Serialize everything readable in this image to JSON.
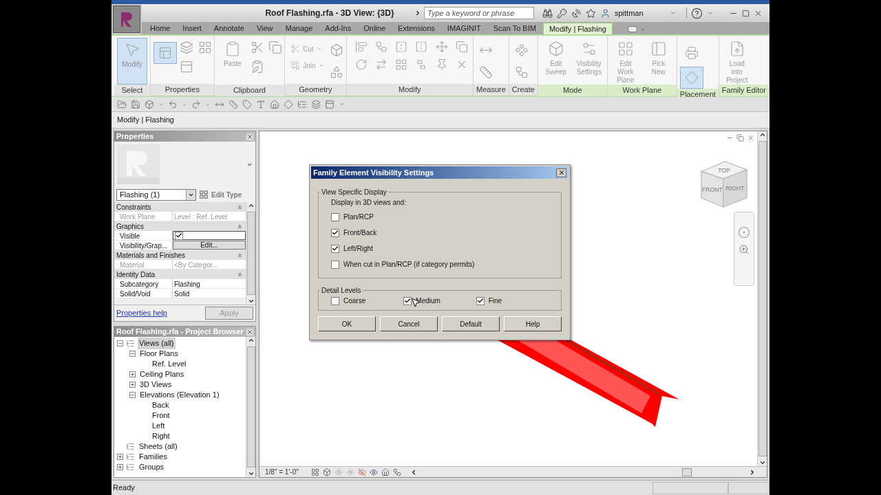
{
  "title_bar": {
    "title": "Roof Flashing.rfa - 3D View: {3D}",
    "search": {
      "placeholder": "Type a keyword or phrase"
    },
    "user": "spittman"
  },
  "ribbon_tabs": [
    {
      "label": "Home",
      "selected": false
    },
    {
      "label": "Insert",
      "selected": false
    },
    {
      "label": "Annotate",
      "selected": false
    },
    {
      "label": "View",
      "selected": false
    },
    {
      "label": "Manage",
      "selected": false
    },
    {
      "label": "Add-Ins",
      "selected": false
    },
    {
      "label": "Online",
      "selected": false
    },
    {
      "label": "Extensions",
      "selected": false
    },
    {
      "label": "IMAGINIT",
      "selected": false
    },
    {
      "label": "Scan To BIM",
      "selected": false
    },
    {
      "label": "Modify | Flashing",
      "selected": true
    }
  ],
  "ribbon_groups": [
    {
      "label": "Select",
      "contextual": false,
      "tools": [
        {
          "kind": "large",
          "label": "Modify",
          "selected": true
        }
      ]
    },
    {
      "label": "Properties",
      "contextual": false,
      "tools": [
        {
          "kind": "toggle",
          "selected": true
        }
      ]
    },
    {
      "label": "Clipboard",
      "contextual": false,
      "tools": [
        {
          "kind": "large",
          "label": "Paste",
          "selected": false
        }
      ]
    },
    {
      "label": "Geometry",
      "contextual": false,
      "tools": [
        {
          "kind": "small",
          "label": "Cut"
        },
        {
          "kind": "small",
          "label": "Join"
        }
      ]
    },
    {
      "label": "Modify",
      "contextual": false
    },
    {
      "label": "Measure",
      "contextual": false
    },
    {
      "label": "Create",
      "contextual": false
    },
    {
      "label": "Mode",
      "contextual": true,
      "tools": [
        {
          "kind": "large",
          "label": "Edit Sweep",
          "selected": false
        },
        {
          "kind": "large",
          "label": "Visibility Settings",
          "selected": false
        }
      ]
    },
    {
      "label": "Work Plane",
      "contextual": true,
      "tools": [
        {
          "kind": "large",
          "label": "Edit Work Plane",
          "selected": false
        },
        {
          "kind": "large",
          "label": "Pick New",
          "selected": false
        }
      ]
    },
    {
      "label": "Placement",
      "contextual": true,
      "tools": [
        {
          "kind": "toggle",
          "selected": false
        },
        {
          "kind": "toggle",
          "selected": true
        }
      ]
    },
    {
      "label": "Family Editor",
      "contextual": true,
      "tools": [
        {
          "kind": "large",
          "label": "Load into Project",
          "selected": false
        }
      ]
    }
  ],
  "options_bar": "Modify | Flashing",
  "properties": {
    "title": "Properties",
    "type_selector": "Flashing (1)",
    "edit_type": "Edit Type",
    "rows": [
      {
        "kind": "section",
        "label": "Constraints"
      },
      {
        "kind": "param",
        "label": "Work Plane",
        "value": "Level : Ref. Level",
        "disabled": true
      },
      {
        "kind": "section",
        "label": "Graphics"
      },
      {
        "kind": "checkbox",
        "label": "Visible",
        "checked": true
      },
      {
        "kind": "button",
        "label": "Visibility/Grap...",
        "value": "Edit..."
      },
      {
        "kind": "section",
        "label": "Materials and Finishes"
      },
      {
        "kind": "param",
        "label": "Material",
        "value": "<By Categor...",
        "disabled": true
      },
      {
        "kind": "section",
        "label": "Identity Data"
      },
      {
        "kind": "param",
        "label": "Subcategory",
        "value": "Flashing",
        "disabled": false
      },
      {
        "kind": "param",
        "label": "Solid/Void",
        "value": "Solid",
        "disabled": false
      }
    ],
    "help": "Properties help",
    "apply": "Apply"
  },
  "project_browser": {
    "title": "Roof Flashing.rfa - Project Browser",
    "tree": [
      {
        "label": "Views (all)",
        "expanded": true,
        "selected": true,
        "children": [
          {
            "label": "Floor Plans",
            "expanded": true,
            "selected": false,
            "children": [
              {
                "label": "Ref. Level",
                "selected": false
              }
            ]
          },
          {
            "label": "Ceiling Plans",
            "expanded": false,
            "selected": false
          },
          {
            "label": "3D Views",
            "expanded": false,
            "selected": false
          },
          {
            "label": "Elevations (Elevation 1)",
            "expanded": true,
            "selected": false,
            "children": [
              {
                "label": "Back",
                "selected": false
              },
              {
                "label": "Front",
                "selected": false
              },
              {
                "label": "Left",
                "selected": false
              },
              {
                "label": "Right",
                "selected": false
              }
            ]
          }
        ]
      },
      {
        "label": "Sheets (all)",
        "selected": false
      },
      {
        "label": "Families",
        "expanded": false,
        "selected": false
      },
      {
        "label": "Groups",
        "expanded": false,
        "selected": false
      }
    ]
  },
  "view": {
    "scale": "1/8\" = 1'-0\"",
    "view_cube": [
      "TOP",
      "FRONT",
      "RIGHT"
    ]
  },
  "dialog": {
    "title": "Family Element Visibility Settings",
    "view_group": "View Specific Display",
    "prompt": "Display in 3D views and:",
    "view_options": [
      {
        "label": "Plan/RCP",
        "checked": false
      },
      {
        "label": "Front/Back",
        "checked": true
      },
      {
        "label": "Left/Right",
        "checked": true
      },
      {
        "label": "When cut in Plan/RCP (if category permits)",
        "checked": false
      }
    ],
    "detail_group": "Detail Levels",
    "detail_levels": [
      {
        "label": "Coarse",
        "checked": false
      },
      {
        "label": "Medium",
        "checked": true
      },
      {
        "label": "Fine",
        "checked": true
      }
    ],
    "buttons": [
      "OK",
      "Cancel",
      "Default",
      "Help"
    ]
  },
  "status_bar": "Ready"
}
